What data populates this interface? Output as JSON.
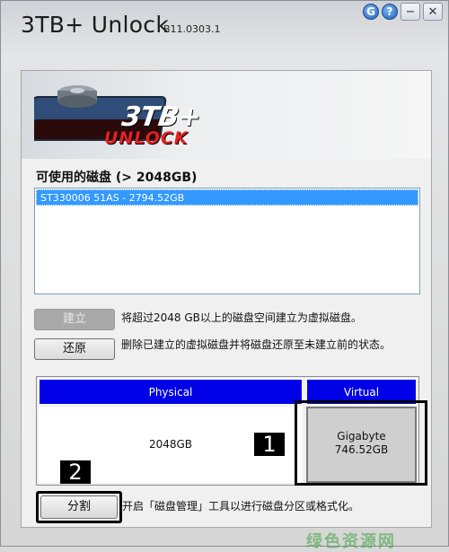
{
  "window": {
    "title": "3TB+ Unlock",
    "build": "B11.0303.1"
  },
  "caption": {
    "help_icon": "?",
    "minimize": "−",
    "close": "✕"
  },
  "logo": {
    "line1": "3TB+",
    "line2": "UNLOCK"
  },
  "disks": {
    "label": "可使用的磁盘 (> 2048GB)",
    "items": [
      "ST330006 51AS - 2794.52GB"
    ]
  },
  "actions": {
    "create_label": "建立",
    "create_desc": "将超过2048 GB以上的磁盘空间建立为虚拟磁盘。",
    "restore_label": "还原",
    "restore_desc": "删除已建立的虚拟磁盘并将磁盘还原至未建立前的状态。",
    "split_label": "分割",
    "split_desc": "开启「磁盘管理」工具以进行磁盘分区或格式化。"
  },
  "table": {
    "headers": [
      "Physical",
      "Virtual"
    ],
    "physical_value": "2048GB",
    "virtual_brand": "Gigabyte",
    "virtual_value": "746.52GB"
  },
  "markers": [
    "1",
    "2"
  ],
  "watermark": "绿色资源网"
}
